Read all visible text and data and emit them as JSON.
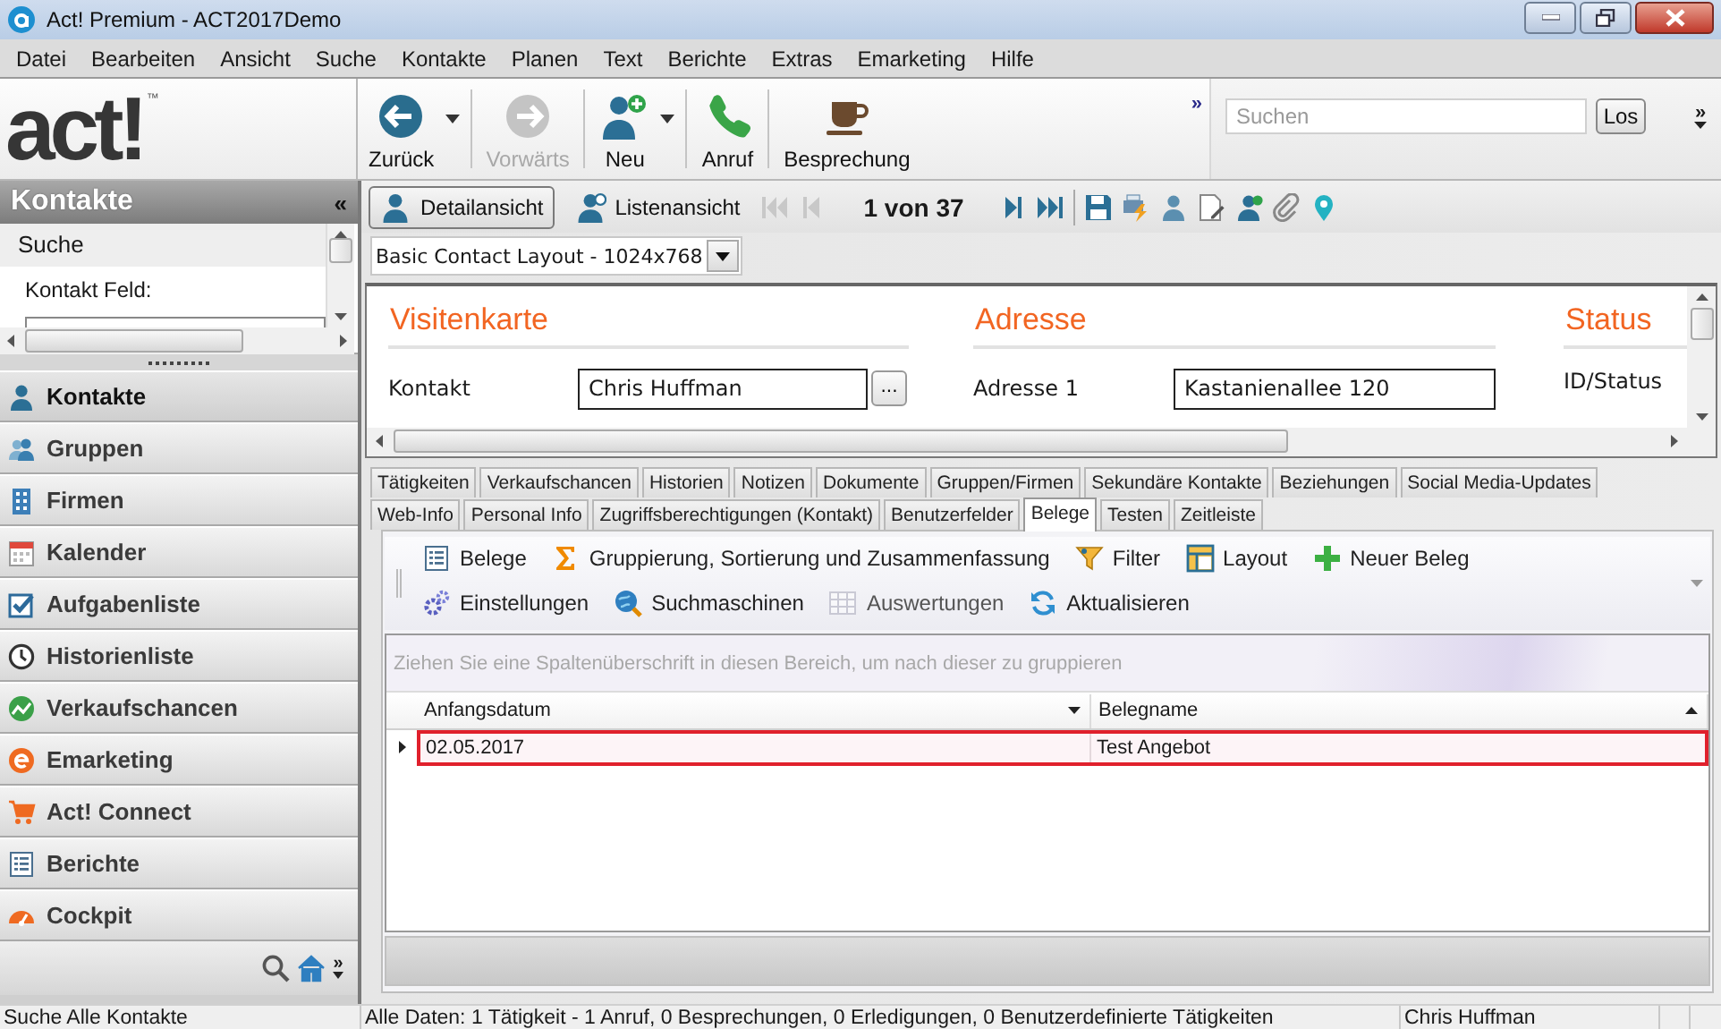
{
  "window": {
    "title": "Act! Premium - ACT2017Demo"
  },
  "menu": [
    "Datei",
    "Bearbeiten",
    "Ansicht",
    "Suche",
    "Kontakte",
    "Planen",
    "Text",
    "Berichte",
    "Extras",
    "Emarketing",
    "Hilfe"
  ],
  "logo": {
    "text": "act!",
    "mark": "™"
  },
  "toolbar": {
    "buttons": [
      {
        "label": "Zurück",
        "disabled": false,
        "dropdown": true
      },
      {
        "label": "Vorwärts",
        "disabled": true,
        "dropdown": false
      },
      {
        "label": "Neu",
        "disabled": false,
        "dropdown": true
      },
      {
        "label": "Anruf",
        "disabled": false,
        "dropdown": false
      },
      {
        "label": "Besprechung",
        "disabled": false,
        "dropdown": false
      }
    ],
    "overflow": "»",
    "search": {
      "placeholder": "Suchen",
      "button": "Los"
    },
    "more": "»"
  },
  "sidebar": {
    "title": "Kontakte",
    "collapse": "«",
    "search_panel": {
      "title": "Suche",
      "field_label": "Kontakt Feld:"
    },
    "nav": [
      {
        "label": "Kontakte",
        "selected": true
      },
      {
        "label": "Gruppen",
        "selected": false
      },
      {
        "label": "Firmen",
        "selected": false
      },
      {
        "label": "Kalender",
        "selected": false
      },
      {
        "label": "Aufgabenliste",
        "selected": false
      },
      {
        "label": "Historienliste",
        "selected": false
      },
      {
        "label": "Verkaufschancen",
        "selected": false
      },
      {
        "label": "Emarketing",
        "selected": false
      },
      {
        "label": "Act! Connect",
        "selected": false
      },
      {
        "label": "Berichte",
        "selected": false
      },
      {
        "label": "Cockpit",
        "selected": false
      }
    ],
    "more": "»"
  },
  "view_toolbar": {
    "views": [
      {
        "label": "Detailansicht",
        "selected": true
      },
      {
        "label": "Listenansicht",
        "selected": false
      }
    ],
    "record_position": "1 von 37"
  },
  "layout_select": {
    "value": "Basic Contact Layout - 1024x768"
  },
  "detail": {
    "sections": [
      {
        "title": "Visitenkarte",
        "fields": [
          {
            "label": "Kontakt",
            "value": "Chris Huffman",
            "button": "..."
          }
        ]
      },
      {
        "title": "Adresse",
        "fields": [
          {
            "label": "Adresse 1",
            "value": "Kastanienallee 120"
          }
        ]
      },
      {
        "title": "Status",
        "fields": [
          {
            "label": "ID/Status"
          }
        ]
      }
    ]
  },
  "tab_rows": [
    [
      {
        "label": "Tätigkeiten",
        "selected": false
      },
      {
        "label": "Verkaufschancen",
        "selected": false
      },
      {
        "label": "Historien",
        "selected": false
      },
      {
        "label": "Notizen",
        "selected": false
      },
      {
        "label": "Dokumente",
        "selected": false
      },
      {
        "label": "Gruppen/Firmen",
        "selected": false
      },
      {
        "label": "Sekundäre Kontakte",
        "selected": false
      },
      {
        "label": "Beziehungen",
        "selected": false
      },
      {
        "label": "Social Media-Updates",
        "selected": false
      }
    ],
    [
      {
        "label": "Web-Info",
        "selected": false
      },
      {
        "label": "Personal Info",
        "selected": false
      },
      {
        "label": "Zugriffsberechtigungen (Kontakt)",
        "selected": false
      },
      {
        "label": "Benutzerfelder",
        "selected": false
      },
      {
        "label": "Belege",
        "selected": true
      },
      {
        "label": "Testen",
        "selected": false
      },
      {
        "label": "Zeitleiste",
        "selected": false
      }
    ]
  ],
  "belege_toolbar": {
    "buttons": [
      {
        "label": "Belege",
        "disabled": false
      },
      {
        "label": "Gruppierung, Sortierung und Zusammenfassung",
        "disabled": false
      },
      {
        "label": "Filter",
        "disabled": false
      },
      {
        "label": "Layout",
        "disabled": false
      },
      {
        "label": "Neuer Beleg",
        "disabled": false
      },
      {
        "label": "Einstellungen",
        "disabled": false
      },
      {
        "label": "Suchmaschinen",
        "disabled": false
      },
      {
        "label": "Auswertungen",
        "disabled": true
      },
      {
        "label": "Aktualisieren",
        "disabled": false
      }
    ]
  },
  "grid": {
    "group_hint": "Ziehen Sie eine Spaltenüberschrift in diesen Bereich, um nach dieser zu gruppieren",
    "columns": [
      {
        "label": "Anfangsdatum",
        "sorted_descending": true
      },
      {
        "label": "Belegname",
        "sorted_descending": false
      }
    ],
    "rows": [
      {
        "cells": [
          "02.05.2017",
          "Test Angebot"
        ],
        "selected": true
      }
    ]
  },
  "status_bar": [
    "Suche Alle Kontakte",
    "Alle Daten: 1 Tätigkeit - 1 Anruf, 0 Besprechungen, 0 Erledigungen, 0 Benutzerdefinierte Tätigkeiten",
    "Chris Huffman"
  ]
}
